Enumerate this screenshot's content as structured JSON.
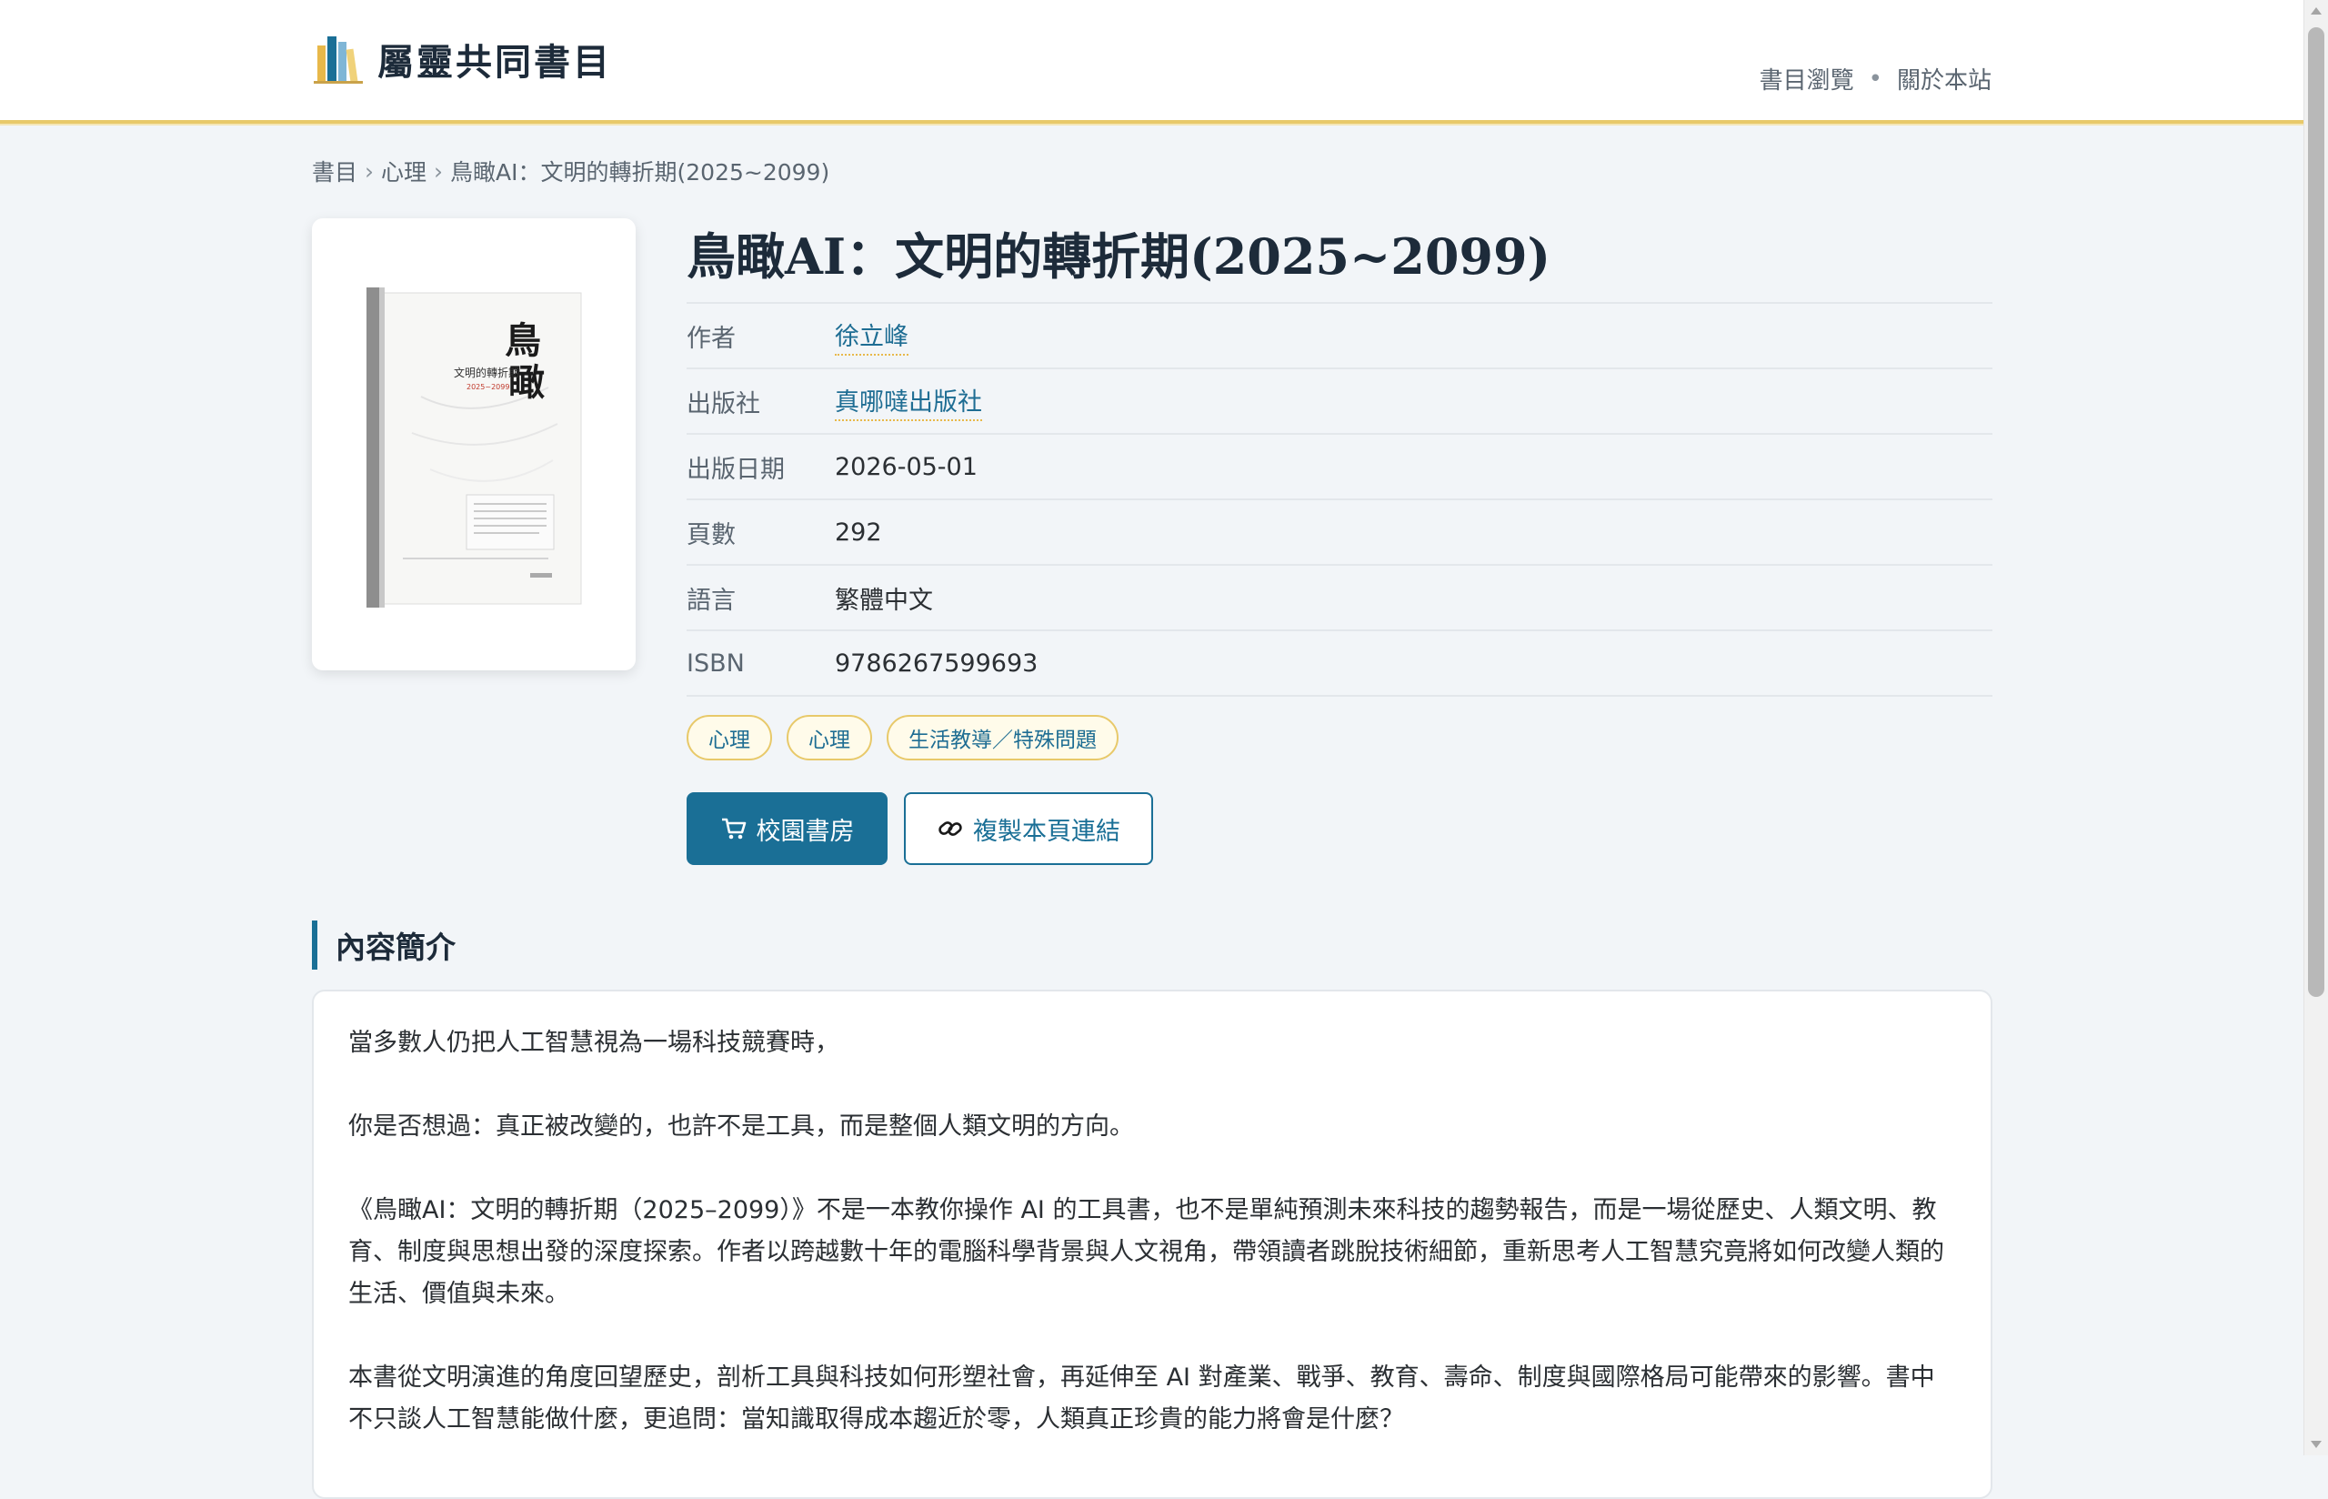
{
  "site": {
    "title": "屬靈共同書目"
  },
  "nav": {
    "browse": "書目瀏覽",
    "separator": "•",
    "about": "關於本站"
  },
  "breadcrumb": {
    "root": "書目",
    "category": "心理",
    "current": "鳥瞰AI：文明的轉折期(2025~2099)",
    "arrow": "›"
  },
  "book": {
    "title": "鳥瞰AI：文明的轉折期(2025~2099)",
    "cover": {
      "big_char_1": "鳥",
      "big_char_2": "瞰",
      "subtitle": "文明的轉折期",
      "years": "2025~2099"
    },
    "meta": [
      {
        "label": "作者",
        "value": "徐立峰",
        "link": true
      },
      {
        "label": "出版社",
        "value": "真哪噠出版社",
        "link": true
      },
      {
        "label": "出版日期",
        "value": "2026-05-01",
        "link": false
      },
      {
        "label": "頁數",
        "value": "292",
        "link": false
      },
      {
        "label": "語言",
        "value": "繁體中文",
        "link": false
      },
      {
        "label": "ISBN",
        "value": "9786267599693",
        "link": false
      }
    ],
    "tags": [
      "心理",
      "心理",
      "生活教導／特殊問題"
    ]
  },
  "actions": {
    "store_label": "校園書房",
    "store_icon": "cart-icon",
    "copy_label": "複製本頁連結",
    "copy_icon": "link-icon"
  },
  "description": {
    "heading": "內容簡介",
    "paragraphs": [
      "當多數人仍把人工智慧視為一場科技競賽時，",
      "你是否想過：真正被改變的，也許不是工具，而是整個人類文明的方向。",
      "《鳥瞰AI：文明的轉折期（2025–2099）》不是一本教你操作 AI 的工具書，也不是單純預測未來科技的趨勢報告，而是一場從歷史、人類文明、教育、制度與思想出發的深度探索。作者以跨越數十年的電腦科學背景與人文視角，帶領讀者跳脫技術細節，重新思考人工智慧究竟將如何改變人類的生活、價值與未來。",
      "本書從文明演進的角度回望歷史，剖析工具與科技如何形塑社會，再延伸至 AI 對產業、戰爭、教育、壽命、制度與國際格局可能帶來的影響。書中不只談人工智慧能做什麼，更追問：當知識取得成本趨近於零，人類真正珍貴的能力將會是什麼？"
    ]
  },
  "colors": {
    "accent": "#1a6f96",
    "gold": "#e8c96a",
    "page_bg": "#f2f5f8"
  }
}
